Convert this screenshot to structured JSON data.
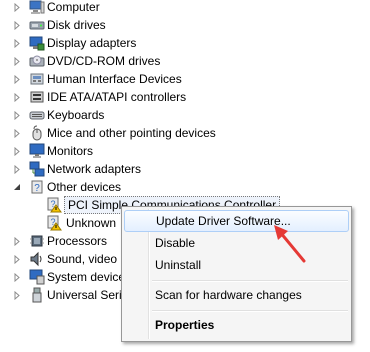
{
  "tree": {
    "items": [
      {
        "label": "Computer",
        "icon": "computer-icon",
        "expanded": false
      },
      {
        "label": "Disk drives",
        "icon": "disk-drive-icon",
        "expanded": false
      },
      {
        "label": "Display adapters",
        "icon": "display-adapter-icon",
        "expanded": false
      },
      {
        "label": "DVD/CD-ROM drives",
        "icon": "dvd-drive-icon",
        "expanded": false
      },
      {
        "label": "Human Interface Devices",
        "icon": "hid-icon",
        "expanded": false
      },
      {
        "label": "IDE ATA/ATAPI controllers",
        "icon": "ide-controller-icon",
        "expanded": false
      },
      {
        "label": "Keyboards",
        "icon": "keyboard-icon",
        "expanded": false
      },
      {
        "label": "Mice and other pointing devices",
        "icon": "mouse-icon",
        "expanded": false
      },
      {
        "label": "Monitors",
        "icon": "monitor-icon",
        "expanded": false
      },
      {
        "label": "Network adapters",
        "icon": "network-adapter-icon",
        "expanded": false
      },
      {
        "label": "Other devices",
        "icon": "other-devices-icon",
        "expanded": true
      },
      {
        "label": "PCI Simple Communications Controller",
        "icon": "warning-device-icon",
        "child": true,
        "selected": true
      },
      {
        "label": "Unknown",
        "icon": "warning-device-icon",
        "child": true
      },
      {
        "label": "Processors",
        "icon": "processor-icon",
        "expanded": false
      },
      {
        "label": "Sound, video",
        "icon": "sound-icon",
        "expanded": false
      },
      {
        "label": "System device",
        "icon": "system-device-icon",
        "expanded": false
      },
      {
        "label": "Universal Seria",
        "icon": "usb-icon",
        "expanded": false
      }
    ]
  },
  "context_menu": {
    "items": [
      {
        "label": "Update Driver Software...",
        "highlighted": true
      },
      {
        "label": "Disable"
      },
      {
        "label": "Uninstall"
      },
      {
        "label": "Scan for hardware changes"
      },
      {
        "label": "Properties",
        "bold": true
      }
    ]
  },
  "colors": {
    "highlight_border": "#aecff7",
    "arrow": "#e53935"
  }
}
